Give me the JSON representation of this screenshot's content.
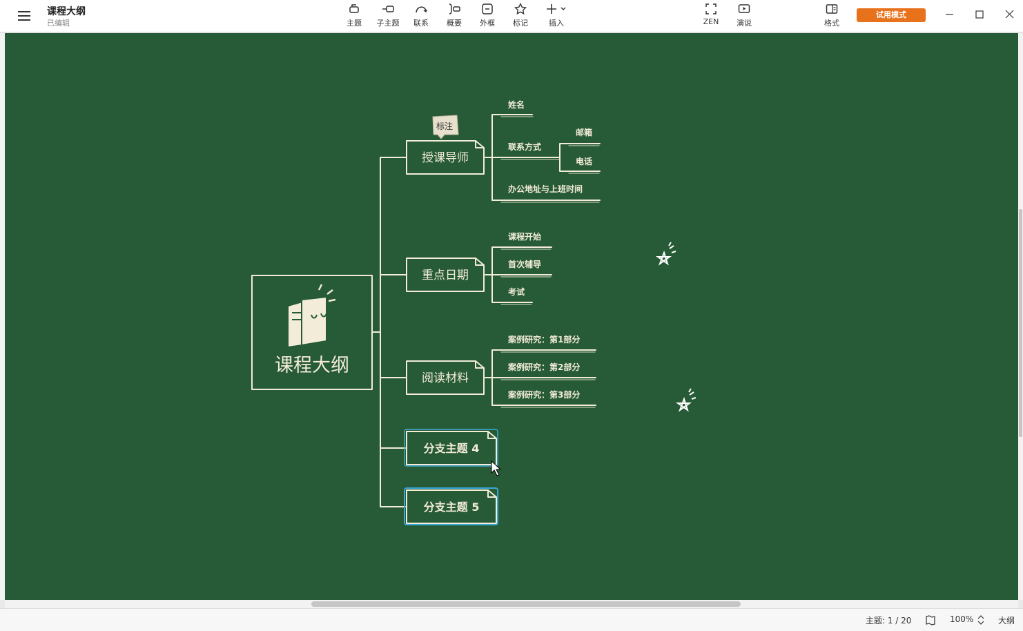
{
  "app": {
    "doc_title": "课程大纲",
    "doc_status": "已编辑"
  },
  "toolbar": {
    "topic": "主题",
    "subtopic": "子主题",
    "relationship": "联系",
    "summary": "概要",
    "boundary": "外框",
    "marker": "标记",
    "insert": "插入",
    "zen": "ZEN",
    "pitch": "演说",
    "format": "格式",
    "trial": "试用模式"
  },
  "mindmap": {
    "central": "课程大纲",
    "callout": "标注",
    "branches": [
      {
        "label": "授课导师",
        "children": [
          "姓名",
          "联系方式",
          "办公地址与上班时间"
        ],
        "sub": [
          "邮箱",
          "电话"
        ]
      },
      {
        "label": "重点日期",
        "children": [
          "课程开始",
          "首次辅导",
          "考试"
        ]
      },
      {
        "label": "阅读材料",
        "children": [
          "案例研究：第1部分",
          "案例研究：第2部分",
          "案例研究：第3部分"
        ]
      },
      {
        "label": "分支主题 4",
        "children": []
      },
      {
        "label": "分支主题 5",
        "children": []
      }
    ]
  },
  "status": {
    "topic_count": "主题: 1 / 20",
    "zoom": "100%",
    "outline": "大纲"
  },
  "colors": {
    "canvas": "#275a36",
    "chalk": "#f2ecd8",
    "accent": "#e8711c",
    "selection": "#3aa9d6"
  }
}
